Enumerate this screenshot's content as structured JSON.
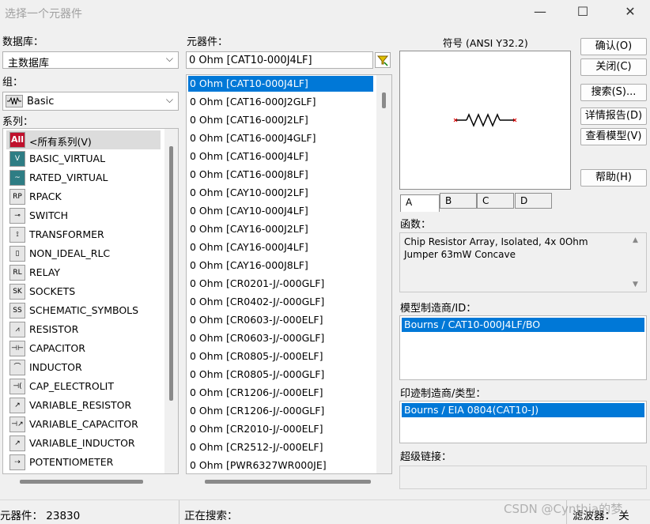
{
  "window": {
    "title": "选择一个元器件",
    "minimize_glyph": "—",
    "maximize_glyph": "☐",
    "close_glyph": "✕"
  },
  "database": {
    "label": "数据库：",
    "value": "主数据库"
  },
  "group": {
    "label": "组：",
    "value": "Basic",
    "icon": "resistor-group-icon"
  },
  "family": {
    "label": "系列：",
    "items": [
      {
        "label": "<所有系列(V)",
        "icon": "All"
      },
      {
        "label": "BASIC_VIRTUAL",
        "icon": "V"
      },
      {
        "label": "RATED_VIRTUAL",
        "icon": "~"
      },
      {
        "label": "RPACK",
        "icon": "RP"
      },
      {
        "label": "SWITCH",
        "icon": "⊸"
      },
      {
        "label": "TRANSFORMER",
        "icon": "⟟"
      },
      {
        "label": "NON_IDEAL_RLC",
        "icon": "▯"
      },
      {
        "label": "RELAY",
        "icon": "RL"
      },
      {
        "label": "SOCKETS",
        "icon": "SK"
      },
      {
        "label": "SCHEMATIC_SYMBOLS",
        "icon": "SS"
      },
      {
        "label": "RESISTOR",
        "icon": "⩘"
      },
      {
        "label": "CAPACITOR",
        "icon": "⊣⊢"
      },
      {
        "label": "INDUCTOR",
        "icon": "⌒"
      },
      {
        "label": "CAP_ELECTROLIT",
        "icon": "⊣("
      },
      {
        "label": "VARIABLE_RESISTOR",
        "icon": "↗"
      },
      {
        "label": "VARIABLE_CAPACITOR",
        "icon": "⊣↗"
      },
      {
        "label": "VARIABLE_INDUCTOR",
        "icon": "↗"
      },
      {
        "label": "POTENTIOMETER",
        "icon": "⇢"
      }
    ]
  },
  "component": {
    "label": "元器件：",
    "search_value": "0 Ohm  [CAT10-000J4LF]",
    "filter_icon": "filter-icon",
    "items": [
      {
        "value": "0 Ohm",
        "part": "[CAT10-000J4LF]"
      },
      {
        "value": "0 Ohm",
        "part": "[CAT16-000J2GLF]"
      },
      {
        "value": "0 Ohm",
        "part": "[CAT16-000J2LF]"
      },
      {
        "value": "0 Ohm",
        "part": "[CAT16-000J4GLF]"
      },
      {
        "value": "0 Ohm",
        "part": "[CAT16-000J4LF]"
      },
      {
        "value": "0 Ohm",
        "part": "[CAT16-000J8LF]"
      },
      {
        "value": "0 Ohm",
        "part": "[CAY10-000J2LF]"
      },
      {
        "value": "0 Ohm",
        "part": "[CAY10-000J4LF]"
      },
      {
        "value": "0 Ohm",
        "part": "[CAY16-000J2LF]"
      },
      {
        "value": "0 Ohm",
        "part": "[CAY16-000J4LF]"
      },
      {
        "value": "0 Ohm",
        "part": "[CAY16-000J8LF]"
      },
      {
        "value": "0 Ohm",
        "part": "[CR0201-J/-000GLF]"
      },
      {
        "value": "0 Ohm",
        "part": "[CR0402-J/-000GLF]"
      },
      {
        "value": "0 Ohm",
        "part": "[CR0603-J/-000ELF]"
      },
      {
        "value": "0 Ohm",
        "part": "[CR0603-J/-000GLF]"
      },
      {
        "value": "0 Ohm",
        "part": "[CR0805-J/-000ELF]"
      },
      {
        "value": "0 Ohm",
        "part": "[CR0805-J/-000GLF]"
      },
      {
        "value": "0 Ohm",
        "part": "[CR1206-J/-000ELF]"
      },
      {
        "value": "0 Ohm",
        "part": "[CR1206-J/-000GLF]"
      },
      {
        "value": "0 Ohm",
        "part": "[CR2010-J/-000ELF]"
      },
      {
        "value": "0 Ohm",
        "part": "[CR2512-J/-000ELF]"
      },
      {
        "value": "0 Ohm",
        "part": "[PWR6327WR000JE]"
      }
    ]
  },
  "symbol": {
    "label": "符号 (ANSI Y32.2)",
    "tabs": [
      "A",
      "B",
      "C",
      "D"
    ]
  },
  "buttons": {
    "ok": "确认(O)",
    "close": "关闭(C)",
    "search": "搜索(S)...",
    "detail_report": "详情报告(D)",
    "view_model": "查看模型(V)",
    "help": "帮助(H)"
  },
  "function": {
    "label": "函数：",
    "text": "Chip Resistor Array, Isolated, 4x 0Ohm Jumper 63mW Concave"
  },
  "model_manufacturer": {
    "label": "模型制造商/ID：",
    "value": "Bourns / CAT10-000J4LF/BO"
  },
  "footprint_manufacturer": {
    "label": "印迹制造商/类型：",
    "value": "Bourns / EIA 0804(CAT10-J)"
  },
  "hyperlink": {
    "label": "超级链接："
  },
  "status": {
    "components": "元器件：  23830",
    "searching": "正在搜索：",
    "filter": "滤波器：  关",
    "watermark": "CSDN @Cynthia的梦"
  }
}
